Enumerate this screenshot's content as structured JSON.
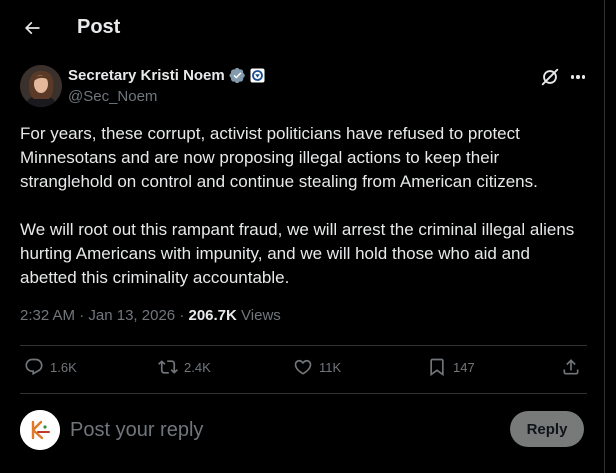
{
  "header": {
    "title": "Post",
    "back_icon": "arrow-left-icon"
  },
  "author": {
    "display_name": "Secretary Kristi Noem",
    "handle": "@Sec_Noem",
    "badges": [
      "gray-verified-badge-icon",
      "dhs-seal-icon"
    ]
  },
  "post": {
    "paragraphs": [
      "For years, these corrupt, activist politicians have refused to protect Minnesotans and are now proposing illegal actions to keep their stranglehold on control and continue stealing from American citizens.",
      "We will root out this rampant fraud, we will arrest the criminal illegal aliens hurting Americans with impunity, and we will hold those who aid and abetted this criminality accountable."
    ],
    "time": "2:32 AM",
    "date": "Jan 13, 2026",
    "separator": "·",
    "views_count": "206.7K",
    "views_label": "Views"
  },
  "actions": {
    "replies": "1.6K",
    "reposts": "2.4K",
    "likes": "11K",
    "bookmarks": "147"
  },
  "composer": {
    "placeholder": "Post your reply",
    "button_label": "Reply"
  },
  "colors": {
    "background": "#000000",
    "text_primary": "#e7e9ea",
    "text_secondary": "#71767b",
    "divider": "#2f3336",
    "reply_button": "#787a7a"
  }
}
